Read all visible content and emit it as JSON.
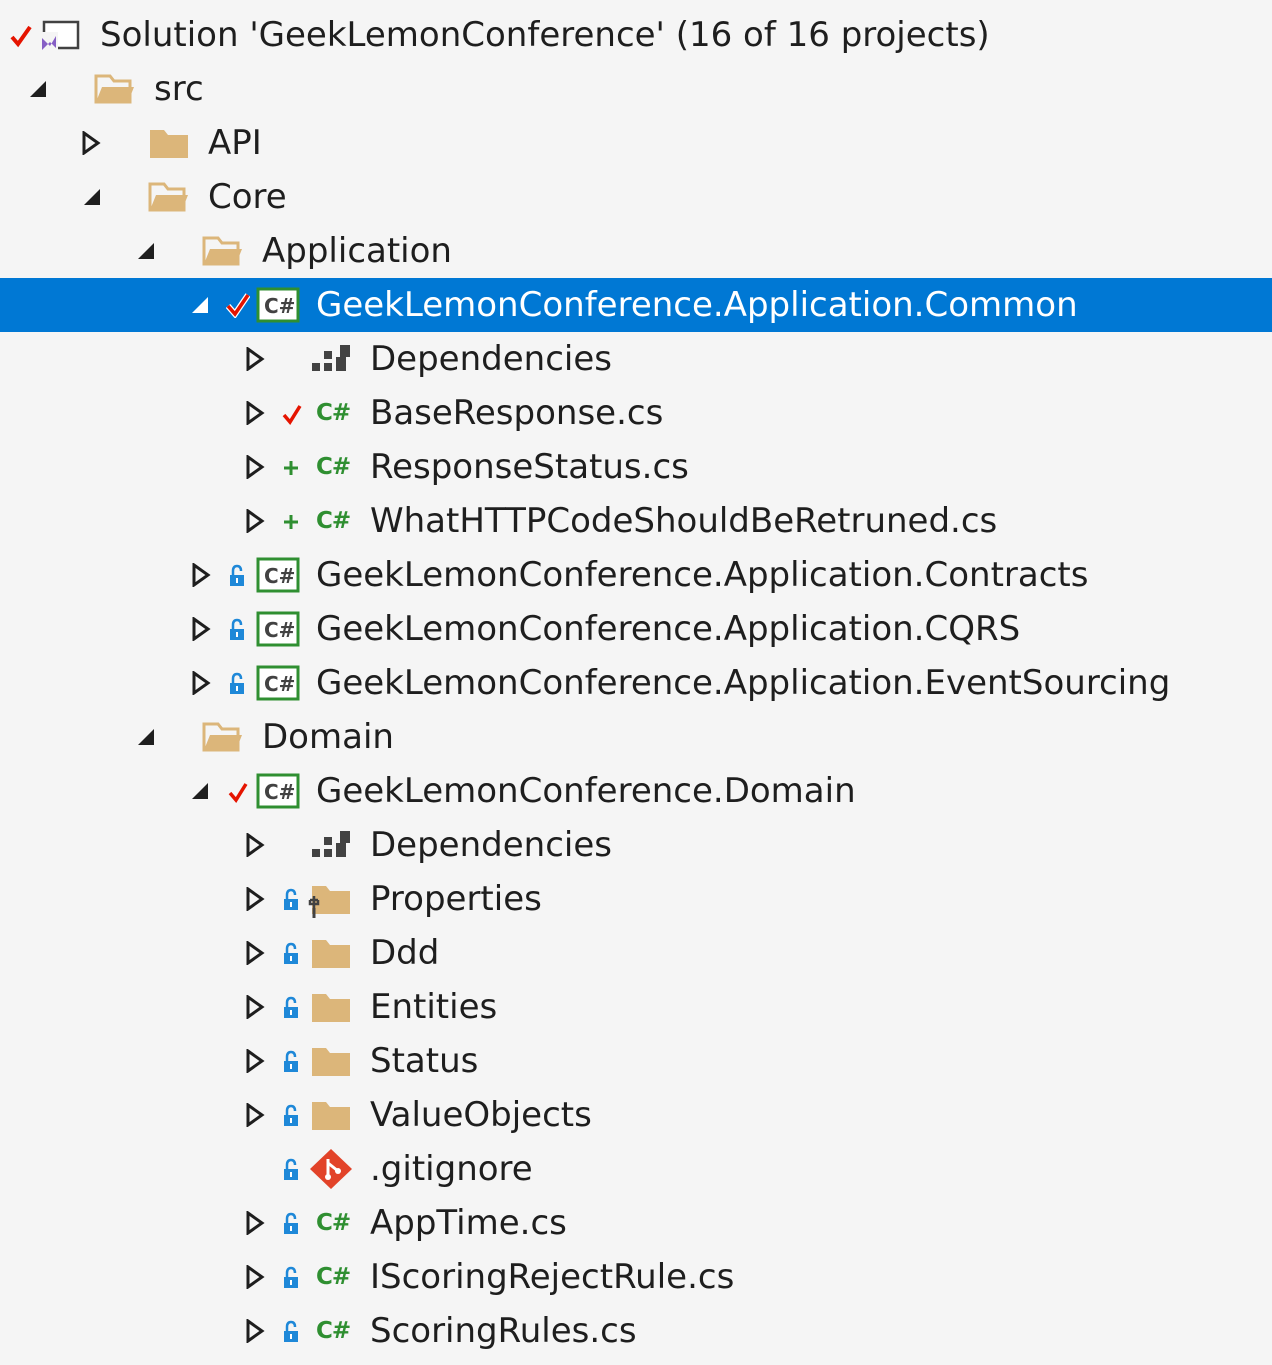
{
  "tree": {
    "rows": [
      {
        "label": "Solution 'GeekLemonConference' (16 of 16 projects)",
        "state": "checked",
        "expander": "none",
        "icon": "solution-icon"
      },
      {
        "label": "src",
        "state": "none",
        "expander": "expanded",
        "icon": "folder-open-icon"
      },
      {
        "label": "API",
        "state": "none",
        "expander": "collapsed",
        "icon": "folder-closed-icon"
      },
      {
        "label": "Core",
        "state": "none",
        "expander": "expanded",
        "icon": "folder-open-icon"
      },
      {
        "label": "Application",
        "state": "none",
        "expander": "expanded",
        "icon": "folder-open-icon"
      },
      {
        "label": "GeekLemonConference.Application.Common",
        "state": "checked",
        "expander": "expanded",
        "icon": "csharp-project-icon",
        "selected": true
      },
      {
        "label": "Dependencies",
        "state": "none",
        "expander": "collapsed",
        "icon": "dependencies-icon"
      },
      {
        "label": "BaseResponse.cs",
        "state": "checked",
        "expander": "collapsed",
        "icon": "csharp-file-icon"
      },
      {
        "label": "ResponseStatus.cs",
        "state": "added",
        "expander": "collapsed",
        "icon": "csharp-file-icon"
      },
      {
        "label": "WhatHTTPCodeShouldBeRetruned.cs",
        "state": "added",
        "expander": "collapsed",
        "icon": "csharp-file-icon"
      },
      {
        "label": "GeekLemonConference.Application.Contracts",
        "state": "locked",
        "expander": "collapsed",
        "icon": "csharp-project-icon"
      },
      {
        "label": "GeekLemonConference.Application.CQRS",
        "state": "locked",
        "expander": "collapsed",
        "icon": "csharp-project-icon"
      },
      {
        "label": "GeekLemonConference.Application.EventSourcing",
        "state": "locked",
        "expander": "collapsed",
        "icon": "csharp-project-icon"
      },
      {
        "label": "Domain",
        "state": "none",
        "expander": "expanded",
        "icon": "folder-open-icon"
      },
      {
        "label": "GeekLemonConference.Domain",
        "state": "checked",
        "expander": "expanded",
        "icon": "csharp-project-icon"
      },
      {
        "label": "Dependencies",
        "state": "none",
        "expander": "collapsed",
        "icon": "dependencies-icon"
      },
      {
        "label": "Properties",
        "state": "locked",
        "expander": "collapsed",
        "icon": "properties-folder-icon"
      },
      {
        "label": "Ddd",
        "state": "locked",
        "expander": "collapsed",
        "icon": "folder-closed-icon"
      },
      {
        "label": "Entities",
        "state": "locked",
        "expander": "collapsed",
        "icon": "folder-closed-icon"
      },
      {
        "label": "Status",
        "state": "locked",
        "expander": "collapsed",
        "icon": "folder-closed-icon"
      },
      {
        "label": "ValueObjects",
        "state": "locked",
        "expander": "collapsed",
        "icon": "folder-closed-icon"
      },
      {
        "label": ".gitignore",
        "state": "locked",
        "expander": "none",
        "icon": "git-icon"
      },
      {
        "label": "AppTime.cs",
        "state": "locked",
        "expander": "collapsed",
        "icon": "csharp-file-icon"
      },
      {
        "label": "IScoringRejectRule.cs",
        "state": "locked",
        "expander": "collapsed",
        "icon": "csharp-file-icon"
      },
      {
        "label": "ScoringRules.cs",
        "state": "locked",
        "expander": "collapsed",
        "icon": "csharp-file-icon"
      }
    ]
  },
  "colors": {
    "selection": "#0078d4",
    "folder": "#dcb67a",
    "check": "#e51400",
    "added": "#2f8f31",
    "lock": "#1e88d8",
    "csharp": "#2f8f31",
    "git": "#e24329",
    "solution": "#865fc5"
  },
  "icons": {
    "check": "checkmark-icon",
    "added": "plus-icon",
    "locked": "lock-icon",
    "expanded": "triangle-expanded-icon",
    "collapsed": "triangle-collapsed-icon"
  }
}
